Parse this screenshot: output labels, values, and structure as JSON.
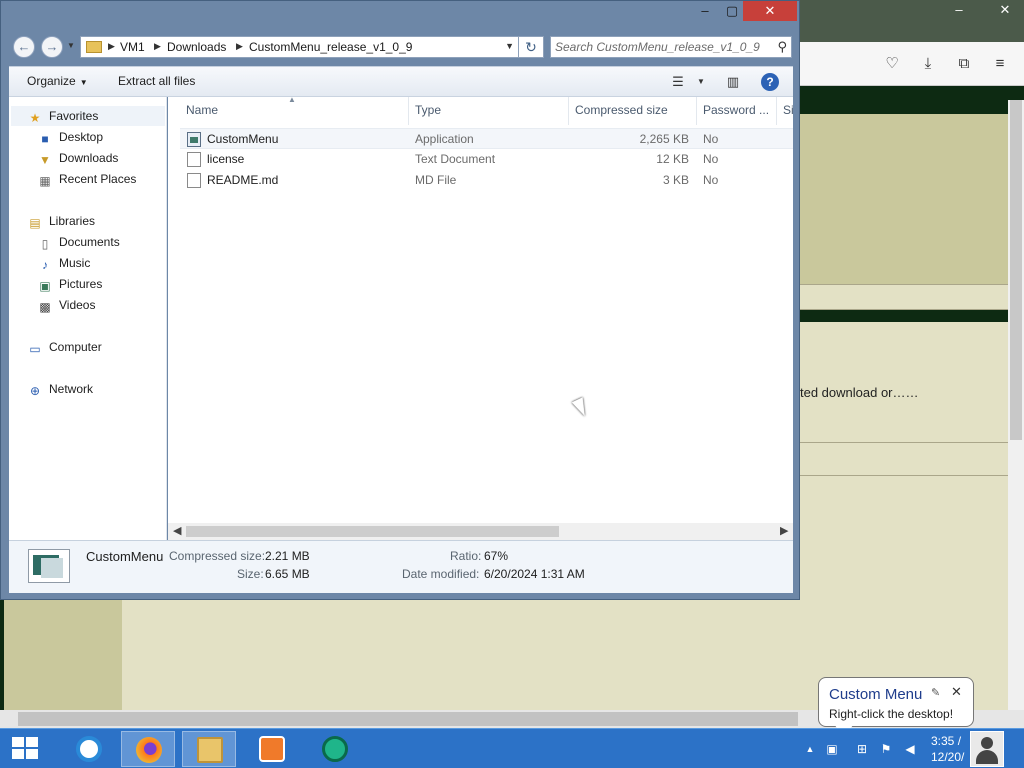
{
  "explorer": {
    "address": {
      "crumbs": [
        "VM1",
        "Downloads",
        "CustomMenu_release_v1_0_9"
      ]
    },
    "search_placeholder": "Search CustomMenu_release_v1_0_9",
    "command_bar": {
      "organize": "Organize",
      "extract_all": "Extract all files"
    },
    "nav": {
      "favorites": "Favorites",
      "desktop": "Desktop",
      "downloads": "Downloads",
      "recent_places": "Recent Places",
      "libraries": "Libraries",
      "documents": "Documents",
      "music": "Music",
      "pictures": "Pictures",
      "videos": "Videos",
      "computer": "Computer",
      "network": "Network"
    },
    "columns": {
      "name": "Name",
      "type": "Type",
      "compressed_size": "Compressed size",
      "password": "Password ...",
      "extra": "Si"
    },
    "files": [
      {
        "name": "CustomMenu",
        "type": "Application",
        "size": "2,265 KB",
        "password": "No"
      },
      {
        "name": "license",
        "type": "Text Document",
        "size": "12 KB",
        "password": "No"
      },
      {
        "name": "README.md",
        "type": "MD File",
        "size": "3 KB",
        "password": "No"
      }
    ],
    "details": {
      "name": "CustomMenu",
      "compressed_size_label": "Compressed size:",
      "compressed_size": "2.21 MB",
      "size_label": "Size:",
      "size": "6.65 MB",
      "ratio_label": "Ratio:",
      "ratio": "67%",
      "date_label": "Date modified:",
      "date": "6/20/2024 1:31 AM"
    }
  },
  "background_page": {
    "snippet": "ted download or……"
  },
  "balloon": {
    "title": "Custom Menu",
    "message": "Right-click the desktop!"
  },
  "taskbar": {
    "clock_time": "3:35 /",
    "clock_date": "12/20/"
  },
  "colors": {
    "taskbar": "#2c72c7",
    "page_background": "#e3e1c5",
    "close_button": "#c7403a",
    "balloon_title": "#1f3d8c"
  }
}
